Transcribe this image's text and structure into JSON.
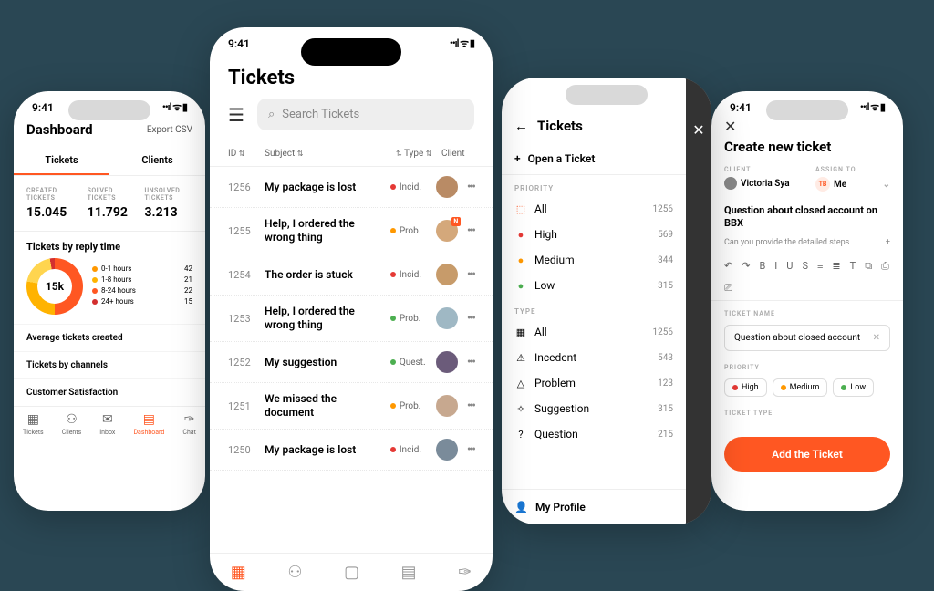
{
  "status_time": "9:41",
  "phone1": {
    "title": "Dashboard",
    "export": "Export CSV",
    "tabs": [
      "Tickets",
      "Clients"
    ],
    "stats": [
      {
        "label": "CREATED TICKETS",
        "value": "15.045"
      },
      {
        "label": "SOLVED TICKETS",
        "value": "11.792"
      },
      {
        "label": "UNSOLVED TICKETS",
        "value": "3.213"
      }
    ],
    "chart_title": "Tickets by reply time",
    "donut_center": "15k",
    "legend": [
      {
        "label": "0-1 hours",
        "value": "42",
        "color": "#ff9800"
      },
      {
        "label": "1-8 hours",
        "value": "21",
        "color": "#ffb300"
      },
      {
        "label": "8-24 hours",
        "value": "22",
        "color": "#ff5722"
      },
      {
        "label": "24+ hours",
        "value": "15",
        "color": "#d32f2f"
      }
    ],
    "rows": [
      "Average tickets created",
      "Tickets by channels",
      "Customer Satisfaction"
    ],
    "bottom_tabs": [
      {
        "label": "Tickets",
        "icon": "▦"
      },
      {
        "label": "Clients",
        "icon": "⚇"
      },
      {
        "label": "Inbox",
        "icon": "✉"
      },
      {
        "label": "Dashboard",
        "icon": "▤",
        "active": true
      },
      {
        "label": "Chat",
        "icon": "✑"
      }
    ]
  },
  "phone2": {
    "title": "Tickets",
    "search_placeholder": "Search Tickets",
    "columns": [
      "ID",
      "Subject",
      "Type",
      "Client"
    ],
    "rows": [
      {
        "id": "1256",
        "subject": "My package is lost",
        "type": "Incid.",
        "dot": "#e53935",
        "avatar": "#b98b65",
        "badge": ""
      },
      {
        "id": "1255",
        "subject": "Help, I ordered the wrong thing",
        "type": "Prob.",
        "dot": "#ff9800",
        "avatar": "#d4a87b",
        "badge": "N"
      },
      {
        "id": "1254",
        "subject": "The order is stuck",
        "type": "Incid.",
        "dot": "#e53935",
        "avatar": "#c79b6a",
        "badge": ""
      },
      {
        "id": "1253",
        "subject": "Help, I ordered the wrong thing",
        "type": "Prob.",
        "dot": "#4caf50",
        "avatar": "#9fb8c4",
        "badge": ""
      },
      {
        "id": "1252",
        "subject": "My suggestion",
        "type": "Quest.",
        "dot": "#4caf50",
        "avatar": "#6b5b7a",
        "badge": ""
      },
      {
        "id": "1251",
        "subject": "We missed the document",
        "type": "Prob.",
        "dot": "#ff9800",
        "avatar": "#c7a88f",
        "badge": ""
      },
      {
        "id": "1250",
        "subject": "My package is lost",
        "type": "Incid.",
        "dot": "#e53935",
        "avatar": "#7a8b9a",
        "badge": ""
      }
    ]
  },
  "phone3": {
    "title": "Tickets",
    "open": "Open a Ticket",
    "priority_label": "PRIORITY",
    "priority": [
      {
        "label": "All",
        "count": "1256",
        "icon": "⬚",
        "color": "#ff5722"
      },
      {
        "label": "High",
        "count": "569",
        "icon": "●",
        "color": "#e53935"
      },
      {
        "label": "Medium",
        "count": "344",
        "icon": "●",
        "color": "#ff9800"
      },
      {
        "label": "Low",
        "count": "315",
        "icon": "●",
        "color": "#4caf50"
      }
    ],
    "type_label": "TYPE",
    "type": [
      {
        "label": "All",
        "count": "1256",
        "icon": "▦"
      },
      {
        "label": "Incedent",
        "count": "543",
        "icon": "⚠"
      },
      {
        "label": "Problem",
        "count": "123",
        "icon": "△"
      },
      {
        "label": "Suggestion",
        "count": "315",
        "icon": "✧"
      },
      {
        "label": "Question",
        "count": "215",
        "icon": "?"
      }
    ],
    "profile": "My Profile"
  },
  "phone4": {
    "title": "Create new ticket",
    "client_label": "CLIENT",
    "client_value": "Victoria Sya",
    "assign_label": "ASSIGN TO",
    "assign_badge": "TB",
    "assign_value": "Me",
    "subject": "Question about closed account on BBX",
    "desc_hint": "Can you provide the detailed steps",
    "toolbar": [
      "↶",
      "↷",
      "B",
      "I",
      "U",
      "S",
      "≡",
      "≣",
      "T",
      "⧉",
      "⎙",
      "⎚"
    ],
    "name_label": "TICKET NAME",
    "name_value": "Question about closed account",
    "priority_label": "PRIORITY",
    "priority_chips": [
      {
        "label": "High",
        "color": "#e53935"
      },
      {
        "label": "Medium",
        "color": "#ff9800"
      },
      {
        "label": "Low",
        "color": "#4caf50"
      }
    ],
    "type_label": "TICKET TYPE",
    "submit": "Add the Ticket"
  },
  "chart_data": {
    "type": "pie",
    "title": "Tickets by reply time",
    "center_label": "15k",
    "series": [
      {
        "name": "0-1 hours",
        "value": 42,
        "color": "#ff9800"
      },
      {
        "name": "1-8 hours",
        "value": 21,
        "color": "#ffb300"
      },
      {
        "name": "8-24 hours",
        "value": 22,
        "color": "#ff5722"
      },
      {
        "name": "24+ hours",
        "value": 15,
        "color": "#d32f2f"
      }
    ]
  }
}
